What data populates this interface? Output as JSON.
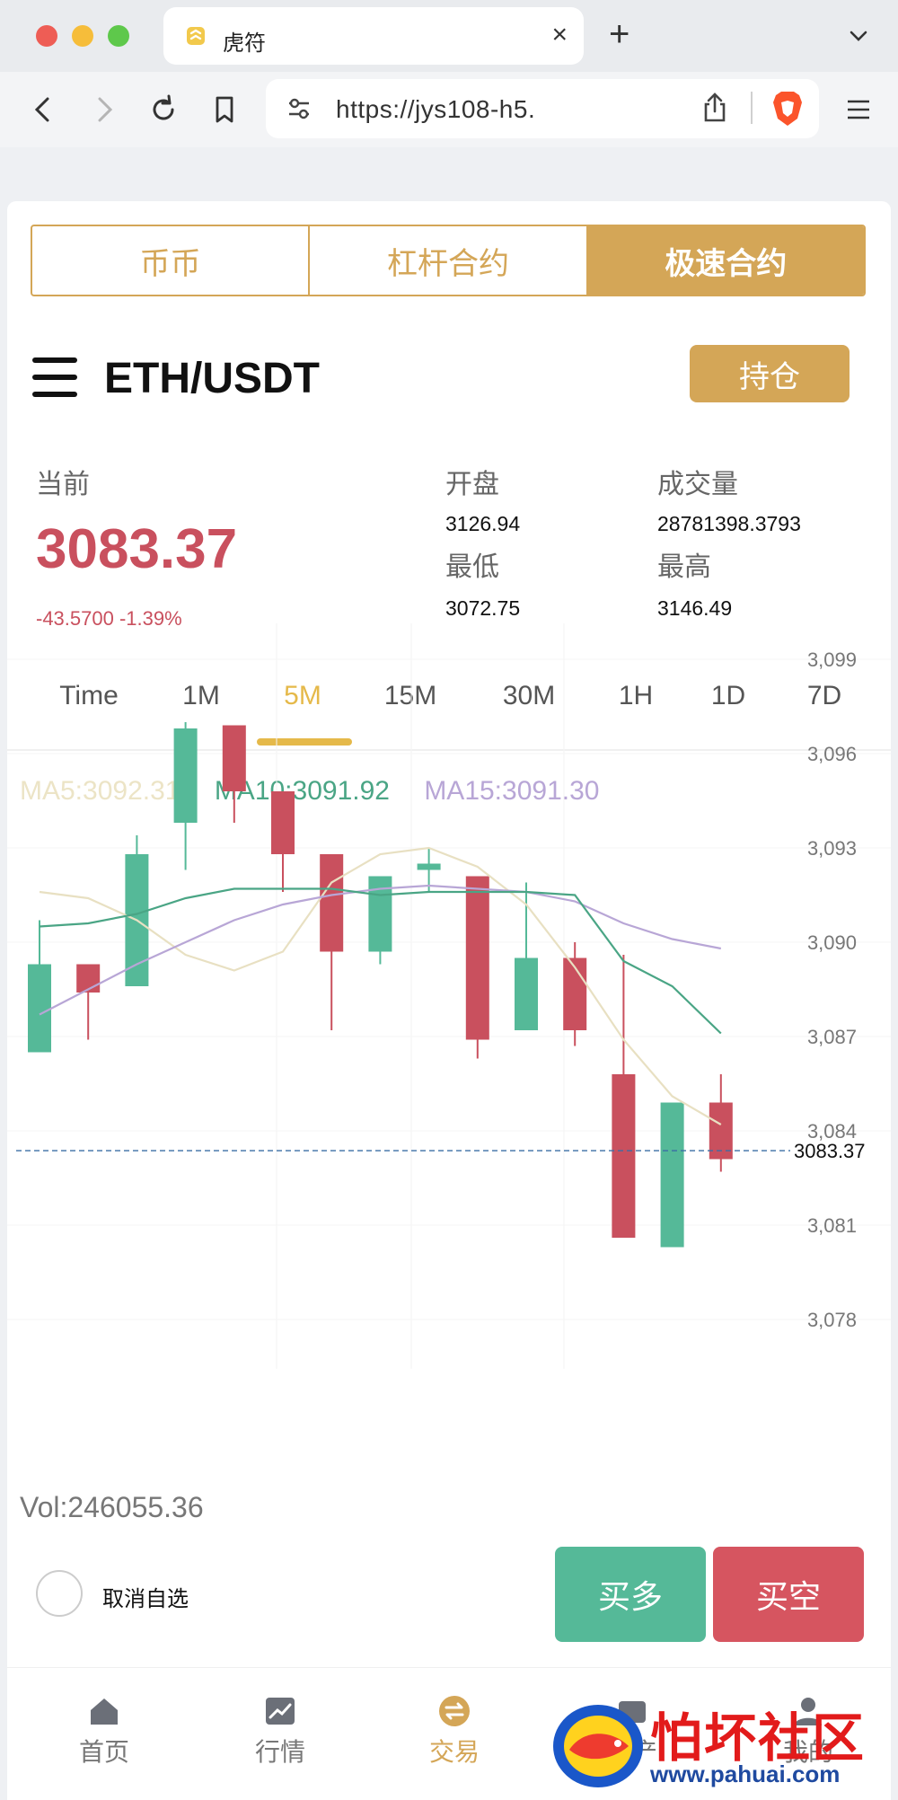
{
  "browser": {
    "tab_title": "虎符",
    "url": "https://jys108-h5.",
    "colors": {
      "brave_orange": "#fb542b"
    }
  },
  "segment": {
    "items": [
      "币币",
      "杠杆合约",
      "极速合约"
    ],
    "active_index": 2
  },
  "pair": {
    "name": "ETH/USDT",
    "hold_button": "持仓"
  },
  "stats": {
    "current_label": "当前",
    "current_price": "3083.37",
    "change": "-43.5700 -1.39%",
    "open_label": "开盘",
    "open_value": "3126.94",
    "low_label": "最低",
    "low_value": "3072.75",
    "volume_label": "成交量",
    "volume_value": "28781398.3793",
    "high_label": "最高",
    "high_value": "3146.49"
  },
  "periods": {
    "items": [
      "Time",
      "1M",
      "5M",
      "15M",
      "30M",
      "1H",
      "1D",
      "7D"
    ],
    "active": "5M"
  },
  "ma": {
    "ma5": "MA5:3092.31",
    "ma10": "MA10:3091.92",
    "ma15": "MA15:3091.30"
  },
  "volume_text": "Vol:246055.36",
  "actions": {
    "favorite_label": "取消自选",
    "buy_long": "买多",
    "sell_short": "买空"
  },
  "bottom_nav": {
    "items": [
      {
        "label": "首页",
        "icon": "home-icon"
      },
      {
        "label": "行情",
        "icon": "chart-icon"
      },
      {
        "label": "交易",
        "icon": "exchange-icon"
      },
      {
        "label": "资产",
        "icon": "wallet-icon"
      },
      {
        "label": "我的",
        "icon": "user-icon"
      }
    ],
    "active_index": 2
  },
  "watermark": {
    "text": "怕坏社区",
    "url": "www.pahuai.com"
  },
  "chart_data": {
    "type": "candlestick",
    "yticks": [
      "3,099",
      "3,096",
      "3,093",
      "3,090",
      "3,087",
      "3,084",
      "3,081",
      "3,078"
    ],
    "ylim": [
      3077.4,
      3099.6
    ],
    "last_price_label": "3083.37",
    "last_price": 3083.37,
    "candles": [
      {
        "o": 3086.5,
        "h": 3090.7,
        "l": 3086.5,
        "c": 3089.3
      },
      {
        "o": 3089.3,
        "h": 3089.3,
        "l": 3086.9,
        "c": 3088.4
      },
      {
        "o": 3088.6,
        "h": 3093.4,
        "l": 3088.6,
        "c": 3092.8
      },
      {
        "o": 3093.8,
        "h": 3097.0,
        "l": 3092.3,
        "c": 3096.8
      },
      {
        "o": 3096.9,
        "h": 3096.9,
        "l": 3093.8,
        "c": 3094.8
      },
      {
        "o": 3094.8,
        "h": 3094.8,
        "l": 3091.6,
        "c": 3092.8
      },
      {
        "o": 3092.8,
        "h": 3092.8,
        "l": 3087.2,
        "c": 3089.7
      },
      {
        "o": 3089.7,
        "h": 3092.1,
        "l": 3089.3,
        "c": 3092.1
      },
      {
        "o": 3092.3,
        "h": 3093.0,
        "l": 3091.6,
        "c": 3092.5
      },
      {
        "o": 3092.1,
        "h": 3092.1,
        "l": 3086.3,
        "c": 3086.9
      },
      {
        "o": 3087.2,
        "h": 3091.9,
        "l": 3087.2,
        "c": 3089.5
      },
      {
        "o": 3089.5,
        "h": 3090.0,
        "l": 3086.7,
        "c": 3087.2
      },
      {
        "o": 3085.8,
        "h": 3089.6,
        "l": 3080.6,
        "c": 3080.6
      },
      {
        "o": 3080.3,
        "h": 3084.9,
        "l": 3080.3,
        "c": 3084.9
      },
      {
        "o": 3084.9,
        "h": 3085.8,
        "l": 3082.7,
        "c": 3083.1
      }
    ],
    "ma5": [
      3091.6,
      3091.4,
      3090.7,
      3089.6,
      3089.1,
      3089.7,
      3091.9,
      3092.8,
      3093.0,
      3092.4,
      3091.2,
      3089.2,
      3086.9,
      3085.1,
      3084.2
    ],
    "ma10": [
      3090.5,
      3090.6,
      3090.9,
      3091.4,
      3091.7,
      3091.7,
      3091.7,
      3091.5,
      3091.6,
      3091.6,
      3091.6,
      3091.5,
      3089.4,
      3088.6,
      3087.1
    ],
    "ma15": [
      3087.7,
      3088.5,
      3089.3,
      3090.0,
      3090.7,
      3091.2,
      3091.5,
      3091.7,
      3091.8,
      3091.7,
      3091.6,
      3091.3,
      3090.6,
      3090.1,
      3089.8
    ],
    "colors": {
      "up": "#55b998",
      "down": "#c9505e",
      "ma5": "#e8e0c2",
      "ma10": "#4aa585",
      "ma15": "#b8a6d6"
    }
  }
}
